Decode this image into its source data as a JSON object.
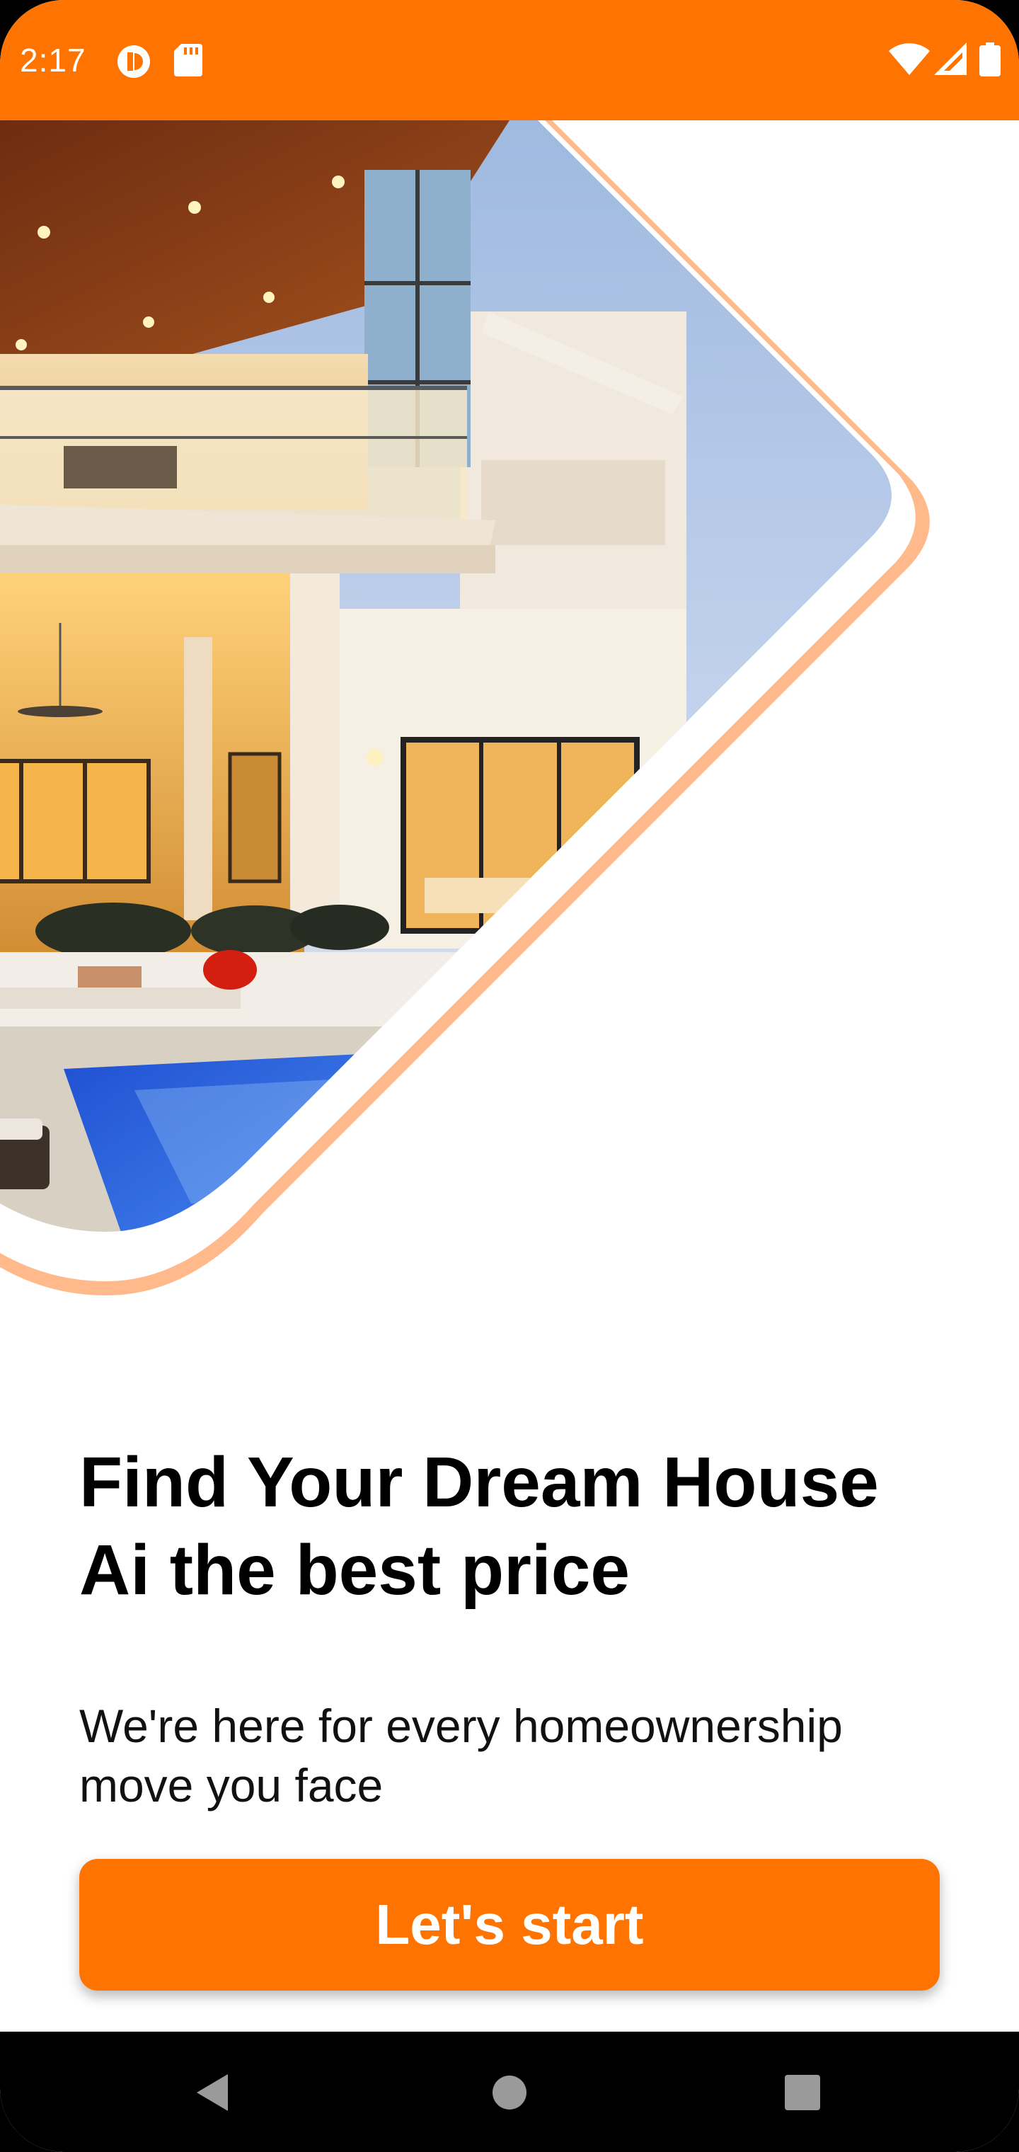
{
  "status_bar": {
    "time": "2:17",
    "left_icons": [
      "vpn-key-icon",
      "sd-card-icon"
    ],
    "right_icons": [
      "wifi-icon",
      "cell-signal-icon",
      "battery-icon"
    ],
    "background_color": "#ff7300"
  },
  "hero": {
    "image": "luxury-house-with-pool-photo",
    "frame_color": "#ffb98a"
  },
  "content": {
    "headline_line1": "Find Your Dream House",
    "headline_line2": "Ai the best price",
    "subtitle_line1": "We're here for every homeownership",
    "subtitle_line2": "move you face"
  },
  "cta": {
    "label": "Let's start",
    "color": "#ff7300"
  },
  "nav_bar": {
    "buttons": [
      "back-icon",
      "home-icon",
      "recents-icon"
    ]
  }
}
